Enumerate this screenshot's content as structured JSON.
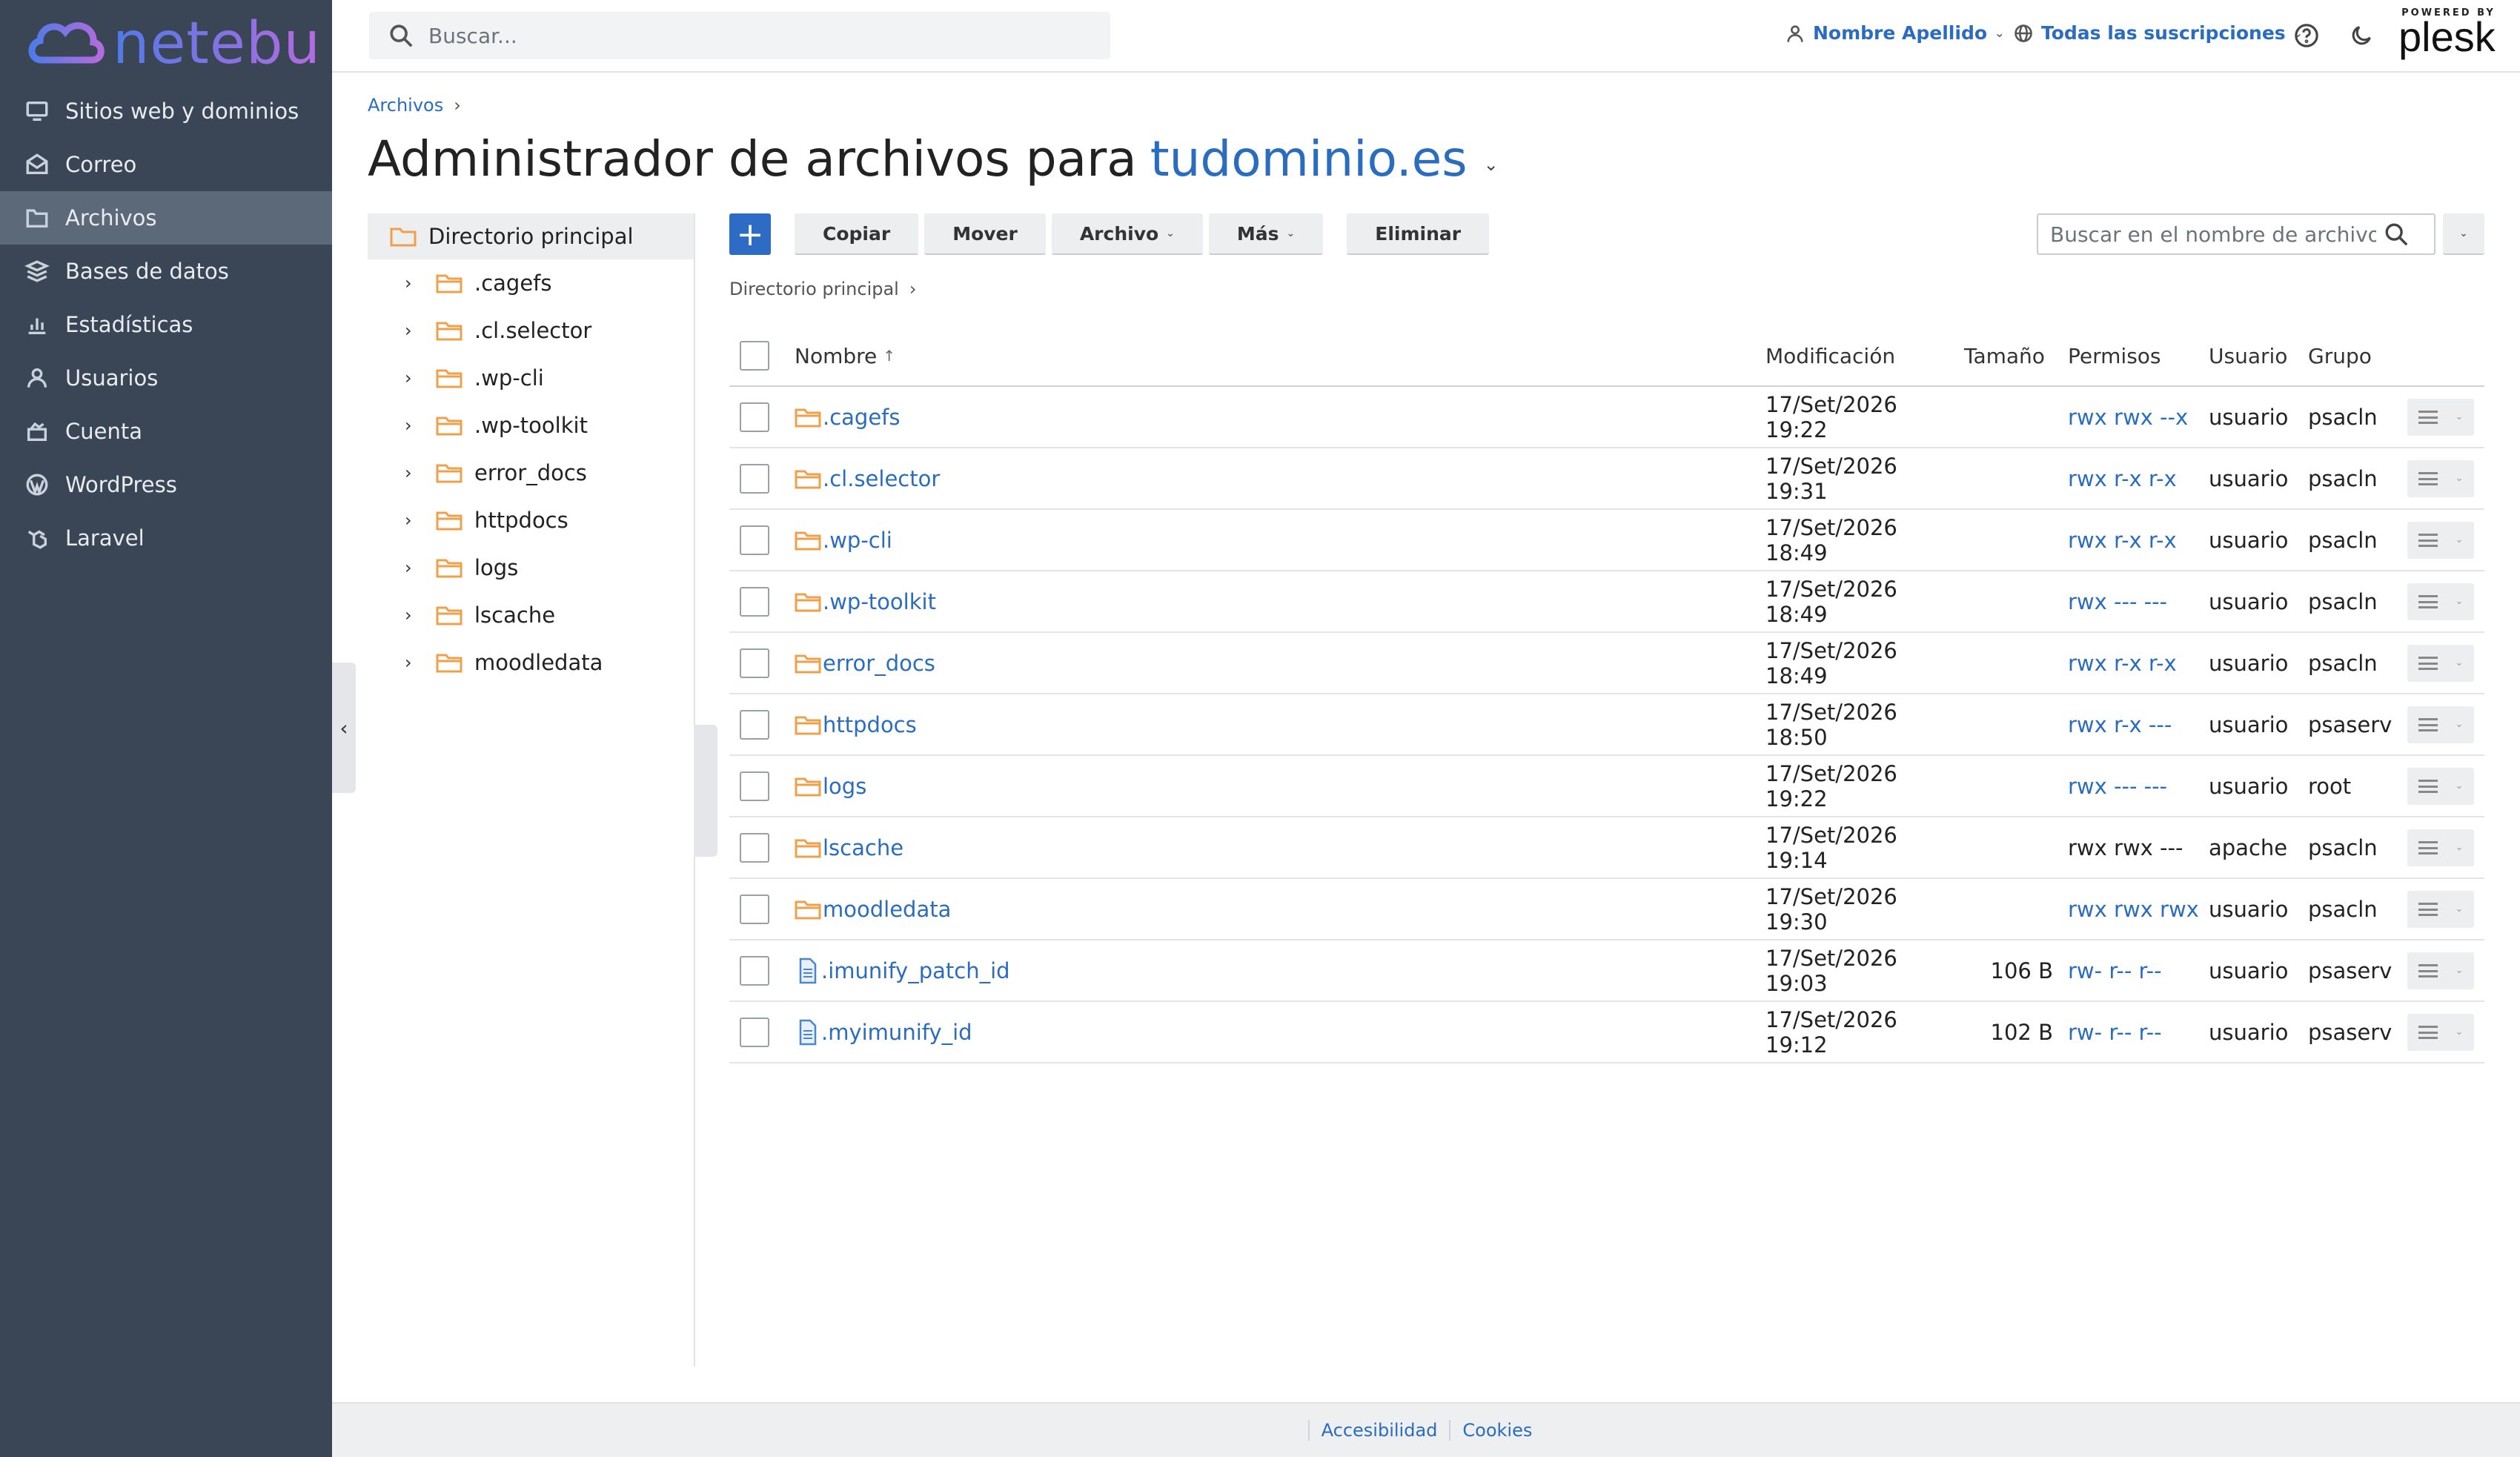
{
  "brand": {
    "name": "netebu"
  },
  "sidebar": {
    "items": [
      {
        "label": "Sitios web y dominios",
        "icon": "monitor-icon"
      },
      {
        "label": "Correo",
        "icon": "mail-icon"
      },
      {
        "label": "Archivos",
        "icon": "folder-icon",
        "active": true
      },
      {
        "label": "Bases de datos",
        "icon": "database-icon"
      },
      {
        "label": "Estadísticas",
        "icon": "bar-chart-icon"
      },
      {
        "label": "Usuarios",
        "icon": "user-icon"
      },
      {
        "label": "Cuenta",
        "icon": "account-icon"
      },
      {
        "label": "WordPress",
        "icon": "wordpress-icon"
      },
      {
        "label": "Laravel",
        "icon": "laravel-icon"
      }
    ]
  },
  "header": {
    "search_placeholder": "Buscar...",
    "user_label": "Nombre Apellido",
    "subscriptions_label": "Todas las suscripciones",
    "powered_by": "POWERED BY",
    "plesk": "plesk"
  },
  "breadcrumb": {
    "root": "Archivos"
  },
  "page": {
    "title_prefix": "Administrador de archivos para",
    "domain": "tudominio.es"
  },
  "tree": {
    "root": "Directorio principal",
    "items": [
      ".cagefs",
      ".cl.selector",
      ".wp-cli",
      ".wp-toolkit",
      "error_docs",
      "httpdocs",
      "logs",
      "lscache",
      "moodledata"
    ]
  },
  "toolbar": {
    "copy": "Copiar",
    "move": "Mover",
    "file": "Archivo",
    "more": "Más",
    "delete": "Eliminar",
    "search_placeholder": "Buscar en el nombre de archivo"
  },
  "current_path": "Directorio principal",
  "table": {
    "headers": {
      "name": "Nombre",
      "modified": "Modificación",
      "size": "Tamaño",
      "perms": "Permisos",
      "user": "Usuario",
      "group": "Grupo"
    },
    "rows": [
      {
        "name": ".cagefs",
        "type": "folder",
        "modified": "17/Set/2026 19:22",
        "size": "",
        "perms": "rwx rwx --x",
        "perms_link": true,
        "user": "usuario",
        "group": "psacln"
      },
      {
        "name": ".cl.selector",
        "type": "folder",
        "modified": "17/Set/2026 19:31",
        "size": "",
        "perms": "rwx r-x r-x",
        "perms_link": true,
        "user": "usuario",
        "group": "psacln"
      },
      {
        "name": ".wp-cli",
        "type": "folder",
        "modified": "17/Set/2026 18:49",
        "size": "",
        "perms": "rwx r-x r-x",
        "perms_link": true,
        "user": "usuario",
        "group": "psacln"
      },
      {
        "name": ".wp-toolkit",
        "type": "folder",
        "modified": "17/Set/2026 18:49",
        "size": "",
        "perms": "rwx --- ---",
        "perms_link": true,
        "user": "usuario",
        "group": "psacln"
      },
      {
        "name": "error_docs",
        "type": "folder",
        "modified": "17/Set/2026 18:49",
        "size": "",
        "perms": "rwx r-x r-x",
        "perms_link": true,
        "user": "usuario",
        "group": "psacln"
      },
      {
        "name": "httpdocs",
        "type": "folder",
        "modified": "17/Set/2026 18:50",
        "size": "",
        "perms": "rwx r-x ---",
        "perms_link": true,
        "user": "usuario",
        "group": "psaserv"
      },
      {
        "name": "logs",
        "type": "folder",
        "modified": "17/Set/2026 19:22",
        "size": "",
        "perms": "rwx --- ---",
        "perms_link": true,
        "user": "usuario",
        "group": "root"
      },
      {
        "name": "lscache",
        "type": "folder",
        "modified": "17/Set/2026 19:14",
        "size": "",
        "perms": "rwx rwx ---",
        "perms_link": false,
        "user": "apache",
        "group": "psacln"
      },
      {
        "name": "moodledata",
        "type": "folder",
        "modified": "17/Set/2026 19:30",
        "size": "",
        "perms": "rwx rwx rwx",
        "perms_link": true,
        "user": "usuario",
        "group": "psacln"
      },
      {
        "name": ".imunify_patch_id",
        "type": "file",
        "modified": "17/Set/2026 19:03",
        "size": "106 B",
        "perms": "rw- r-- r--",
        "perms_link": true,
        "user": "usuario",
        "group": "psaserv"
      },
      {
        "name": ".myimunify_id",
        "type": "file",
        "modified": "17/Set/2026 19:12",
        "size": "102 B",
        "perms": "rw- r-- r--",
        "perms_link": true,
        "user": "usuario",
        "group": "psaserv"
      }
    ]
  },
  "footer": {
    "accessibility": "Accesibilidad",
    "cookies": "Cookies"
  },
  "colors": {
    "sidebar_bg": "#3a4656",
    "link": "#2a6cbf",
    "primary": "#2d6bc4",
    "folder": "#f0a04b"
  }
}
